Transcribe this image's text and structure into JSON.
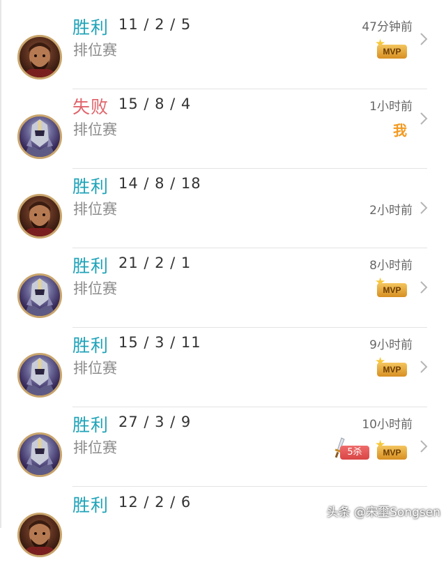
{
  "matches": [
    {
      "result": "胜利",
      "outcome": "win",
      "kda": "11 / 2 / 5",
      "mode": "排位赛",
      "time": "47分钟前",
      "hero": "warrior",
      "badges": [
        "mvp"
      ]
    },
    {
      "result": "失败",
      "outcome": "loss",
      "kda": "15 / 8 / 4",
      "mode": "排位赛",
      "time": "1小时前",
      "hero": "knight",
      "badges": [
        "me"
      ]
    },
    {
      "result": "胜利",
      "outcome": "win",
      "kda": "14 / 8 / 18",
      "mode": "排位赛",
      "time": "2小时前",
      "hero": "warrior",
      "badges": []
    },
    {
      "result": "胜利",
      "outcome": "win",
      "kda": "21 / 2 / 1",
      "mode": "排位赛",
      "time": "8小时前",
      "hero": "knight",
      "badges": [
        "mvp"
      ]
    },
    {
      "result": "胜利",
      "outcome": "win",
      "kda": "15 / 3 / 11",
      "mode": "排位赛",
      "time": "9小时前",
      "hero": "knight",
      "badges": [
        "mvp"
      ]
    },
    {
      "result": "胜利",
      "outcome": "win",
      "kda": "27 / 3 / 9",
      "mode": "排位赛",
      "time": "10小时前",
      "hero": "knight",
      "badges": [
        "kills",
        "mvp"
      ]
    },
    {
      "result": "胜利",
      "outcome": "win",
      "kda": "12 / 2 / 6",
      "mode": "",
      "time": "",
      "hero": "warrior",
      "badges": []
    }
  ],
  "labels": {
    "mvp": "MVP",
    "me": "我",
    "kills": "5杀"
  },
  "colors": {
    "win": "#1fa3b8",
    "loss": "#e0646b",
    "mvp": "#e4a23a"
  },
  "watermark": "头条 @宋璽Songsen"
}
